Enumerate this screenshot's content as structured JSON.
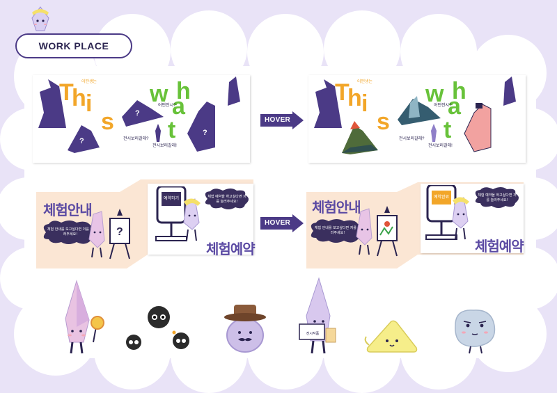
{
  "header": {
    "title": "WORK PLACE"
  },
  "row1": {
    "before": {
      "letters": [
        "T",
        "h",
        "i",
        "s",
        "w",
        "h",
        "a",
        "t"
      ],
      "small_1": "어떤생는",
      "small_2": "어떤전시?",
      "caption_1": "전시보러갈래?",
      "caption_2": "전시보러갈래!"
    },
    "hover_label": "HOVER",
    "after": {
      "letters": [
        "T",
        "h",
        "i",
        "s",
        "w",
        "h",
        "a",
        "t"
      ],
      "small_1": "어떤생는",
      "small_2": "어떤전시?",
      "caption_1": "전시보러갈래?",
      "caption_2": "전시보러갈래!"
    }
  },
  "row2": {
    "before": {
      "title_left": "체험안내",
      "bubble_left": "체험 안내를 보고싶다면 저를 눌러주세요!",
      "screen_label": "예약하기",
      "bubble_right": "체험 예약을 하고싶다면 저를 눌러주세요!",
      "title_right": "체험예약"
    },
    "hover_label": "HOVER",
    "after": {
      "title_left": "체험안내",
      "bubble_left": "체험 안내를 보고싶다면 저를 눌러주세요!",
      "screen_label": "예약완료",
      "bubble_right": "체험 예약을 하고싶다면 저를 눌러주세요!",
      "title_right": "체험예약"
    }
  },
  "characters": {
    "sign_label": "전시작품"
  },
  "colors": {
    "background": "#e9e3f7",
    "cloud": "#ffffff",
    "purple": "#4b3a86",
    "orange": "#f2a629",
    "green": "#68c23a",
    "peach": "#fbe6d4"
  }
}
